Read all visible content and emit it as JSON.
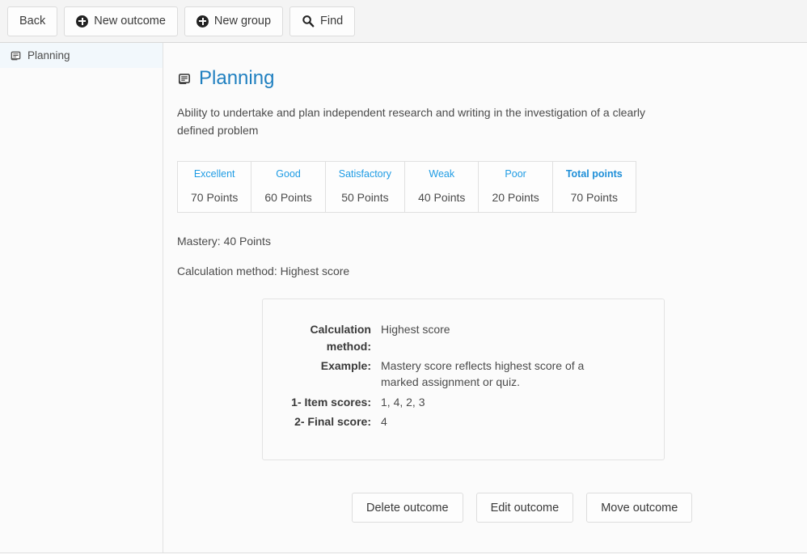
{
  "toolbar": {
    "buttons": [
      {
        "label": "Back",
        "icon": null
      },
      {
        "label": "New outcome",
        "icon": "plus-circle-icon"
      },
      {
        "label": "New group",
        "icon": "plus-circle-icon"
      },
      {
        "label": "Find",
        "icon": "search-icon"
      }
    ]
  },
  "sidebar": {
    "items": [
      {
        "label": "Planning",
        "icon": "outcome-icon",
        "selected": true
      }
    ]
  },
  "main": {
    "title": "Planning",
    "title_icon": "outcome-icon",
    "description": "Ability to undertake and plan independent research and writing in the investigation of a clearly defined problem",
    "ratings": {
      "headers": [
        "Excellent",
        "Good",
        "Satisfactory",
        "Weak",
        "Poor",
        "Total points"
      ],
      "values": [
        "70 Points",
        "60 Points",
        "50 Points",
        "40 Points",
        "20 Points",
        "70 Points"
      ]
    },
    "mastery_line": "Mastery: 40 Points",
    "calculation_line": "Calculation method: Highest score",
    "detail_box": {
      "rows": [
        {
          "label": "Calculation method:",
          "value": "Highest score"
        },
        {
          "label": "Example:",
          "value": "Mastery score reflects highest score of a marked assignment or quiz."
        },
        {
          "label": "1- Item scores:",
          "value": "1, 4, 2, 3"
        },
        {
          "label": "2- Final score:",
          "value": "4"
        }
      ]
    },
    "actions": [
      {
        "label": "Delete outcome"
      },
      {
        "label": "Edit outcome"
      },
      {
        "label": "Move outcome"
      }
    ]
  },
  "colors": {
    "title_blue": "#2080c0",
    "header_blue": "#1f9ce4",
    "toolbar_bg": "#f4f4f4",
    "selected_item_bg": "#f2f8fc"
  }
}
